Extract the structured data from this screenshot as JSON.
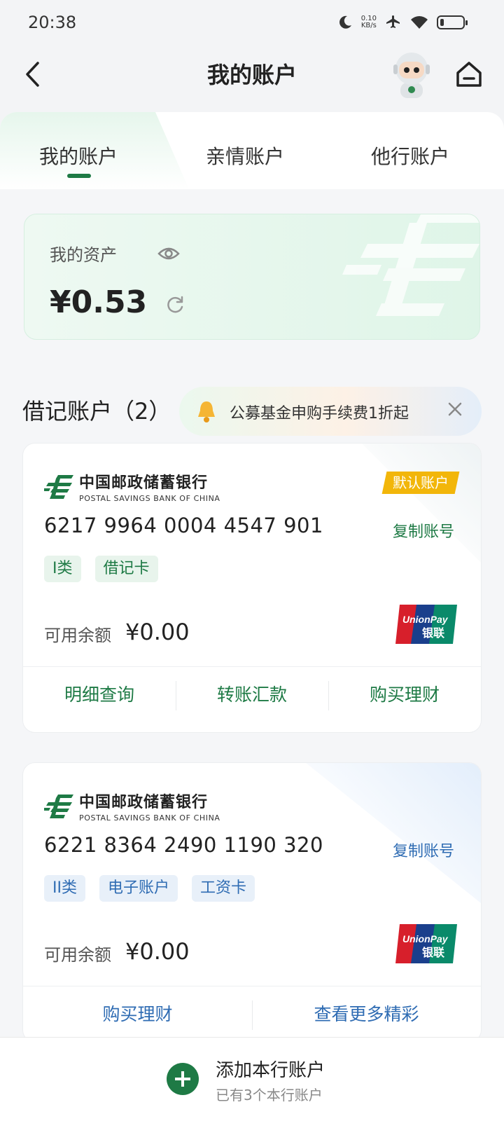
{
  "status_bar": {
    "time": "20:38",
    "speed_value": "0.10",
    "speed_unit": "KB/s",
    "icons": [
      "moon-icon",
      "airplane-icon",
      "wifi-icon",
      "battery-icon"
    ]
  },
  "header": {
    "title": "我的账户"
  },
  "tabs": [
    {
      "label": "我的账户",
      "active": true
    },
    {
      "label": "亲情账户",
      "active": false
    },
    {
      "label": "他行账户",
      "active": false
    }
  ],
  "assets": {
    "label": "我的资产",
    "amount": "¥0.53"
  },
  "debit_section": {
    "title": "借记账户（2）",
    "promo_text": "公募基金申购手续费1折起"
  },
  "bank": {
    "name_cn": "中国邮政储蓄银行",
    "name_en": "POSTAL SAVINGS BANK OF CHINA"
  },
  "accounts": [
    {
      "badge": "默认账户",
      "number": "6217 9964 0004 4547 901",
      "copy_label": "复制账号",
      "tags": [
        "I类",
        "借记卡"
      ],
      "balance_label": "可用余额",
      "balance": "¥0.00",
      "actions": [
        "明细查询",
        "转账汇款",
        "购买理财"
      ]
    },
    {
      "number": "6221 8364 2490 1190 320",
      "copy_label": "复制账号",
      "tags": [
        "II类",
        "电子账户",
        "工资卡"
      ],
      "balance_label": "可用余额",
      "balance": "¥0.00",
      "actions": [
        "购买理财",
        "查看更多精彩"
      ]
    }
  ],
  "bottom_bar": {
    "title": "添加本行账户",
    "subtitle": "已有3个本行账户"
  },
  "colors": {
    "brand_green": "#1e7a45",
    "accent_blue": "#2f6cb3",
    "badge_yellow": "#f2b60a"
  }
}
